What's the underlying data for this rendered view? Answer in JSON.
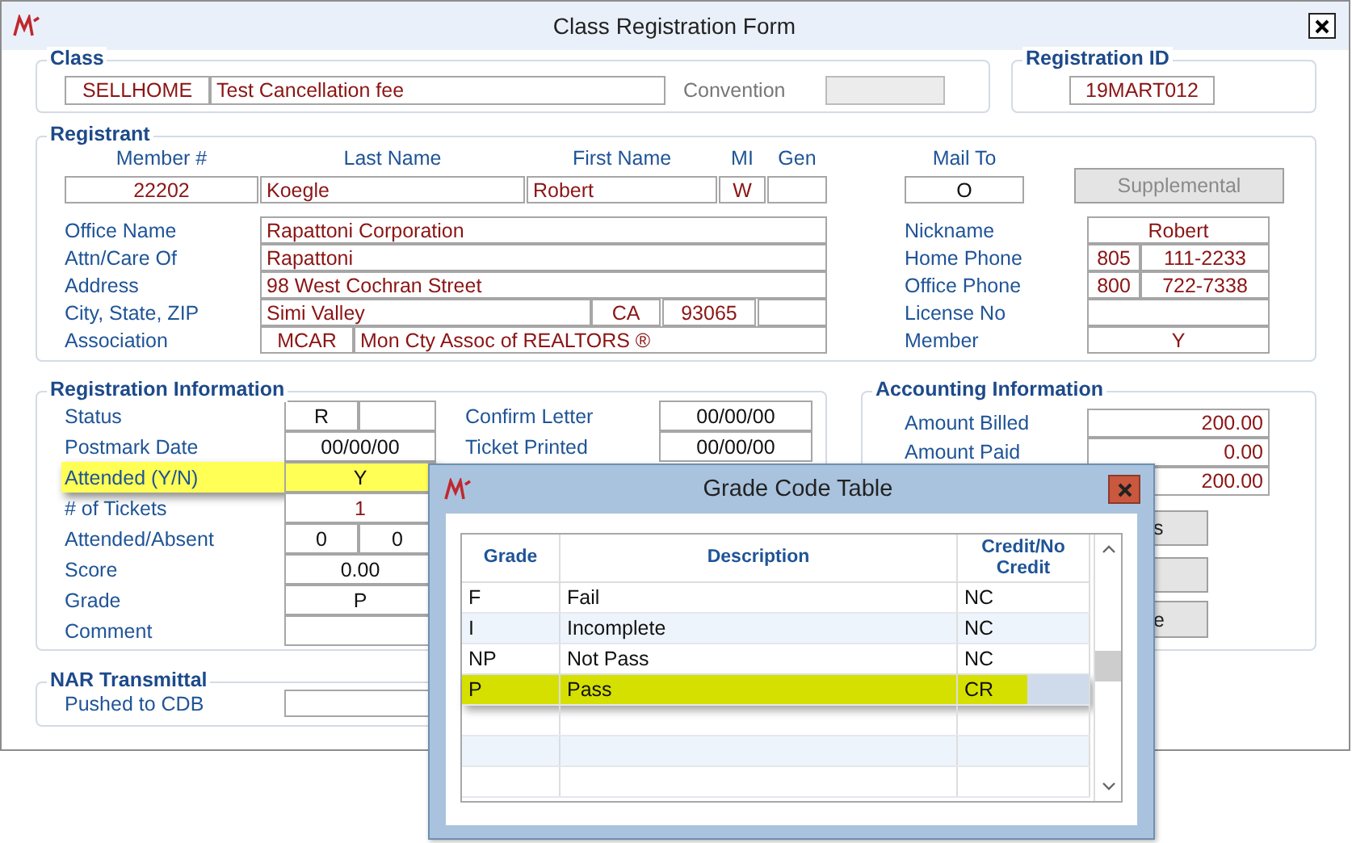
{
  "window": {
    "title": "Class Registration Form"
  },
  "class": {
    "title": "Class",
    "code": "SELLHOME",
    "name": "Test Cancellation fee",
    "convention": {
      "label": "Convention",
      "disabled": true
    }
  },
  "registration_id": {
    "title": "Registration ID",
    "value": "19MART012"
  },
  "registrant": {
    "title": "Registrant",
    "headers": [
      "Member #",
      "Last Name",
      "First Name",
      "MI",
      "Gen"
    ],
    "values": [
      "22202",
      "Koegle",
      "Robert",
      "W"
    ],
    "mail_to": {
      "label": "Mail To",
      "value": "O"
    },
    "supplemental": {
      "label": "Supplemental",
      "disabled": true
    },
    "left_rows": [
      {
        "label": "Office Name",
        "values": [
          "Rapattoni Corporation"
        ]
      },
      {
        "label": "Attn/Care Of",
        "values": [
          "Rapattoni"
        ]
      },
      {
        "label": "Address",
        "values": [
          "98 West Cochran Street"
        ]
      },
      {
        "label": "City, State, ZIP",
        "values": [
          "Simi Valley",
          "CA",
          "93065"
        ]
      },
      {
        "label": "Association",
        "values": [
          "MCAR",
          "Mon Cty Assoc of REALTORS ®"
        ]
      }
    ],
    "right_rows": [
      {
        "label": "Nickname",
        "values": [
          "Robert"
        ]
      },
      {
        "label": "Home Phone",
        "values": [
          "805",
          "111-2233"
        ]
      },
      {
        "label": "Office Phone",
        "values": [
          "800",
          "722-7338"
        ]
      },
      {
        "label": "License No",
        "values": []
      },
      {
        "label": "Member",
        "values": [
          "Y"
        ]
      }
    ]
  },
  "registration_info": {
    "title": "Registration Information",
    "rows": [
      {
        "label": "Status",
        "values": [
          "R"
        ],
        "highlighted": false
      },
      {
        "label": "Postmark Date",
        "values": [
          "00/00/00"
        ],
        "highlighted": false
      },
      {
        "label": "Attended (Y/N)",
        "values": [
          "Y"
        ],
        "highlighted": true
      },
      {
        "label": "# of Tickets",
        "values": [
          "1"
        ],
        "highlighted": false
      },
      {
        "label": "Attended/Absent",
        "values": [
          "0",
          "0"
        ],
        "highlighted": false
      },
      {
        "label": "Score",
        "values": [
          "0.00"
        ],
        "highlighted": false
      },
      {
        "label": "Grade",
        "values": [
          "P"
        ],
        "highlighted": false
      },
      {
        "label": "Comment",
        "values": [],
        "highlighted": false
      }
    ],
    "right_rows": [
      {
        "label": "Confirm Letter",
        "value": "00/00/00"
      },
      {
        "label": "Ticket Printed",
        "value": "00/00/00"
      }
    ]
  },
  "accounting": {
    "title": "Accounting Information",
    "rows": [
      {
        "label": "Amount Billed",
        "value": "200.00"
      },
      {
        "label": "Amount Paid",
        "value": "0.00"
      },
      {
        "value": "200.00"
      }
    ],
    "buttons": [
      {
        "label": "s"
      },
      {
        "label": "e"
      }
    ]
  },
  "nar": {
    "title": "NAR Transmittal",
    "rows": [
      {
        "label": "Pushed to CDB"
      }
    ]
  },
  "grade_table": {
    "title": "Grade Code Table",
    "columns": [
      "Grade",
      "Description",
      "Credit/No Credit"
    ],
    "rows": [
      {
        "grade": "F",
        "description": "Fail",
        "credit": "NC",
        "selected": false,
        "highlighted": false
      },
      {
        "grade": "I",
        "description": "Incomplete",
        "credit": "NC",
        "selected": false,
        "highlighted": false
      },
      {
        "grade": "NP",
        "description": "Not Pass",
        "credit": "NC",
        "selected": false,
        "highlighted": false
      },
      {
        "grade": "P",
        "description": "Pass",
        "credit": "CR",
        "selected": true,
        "highlighted": true
      }
    ]
  }
}
